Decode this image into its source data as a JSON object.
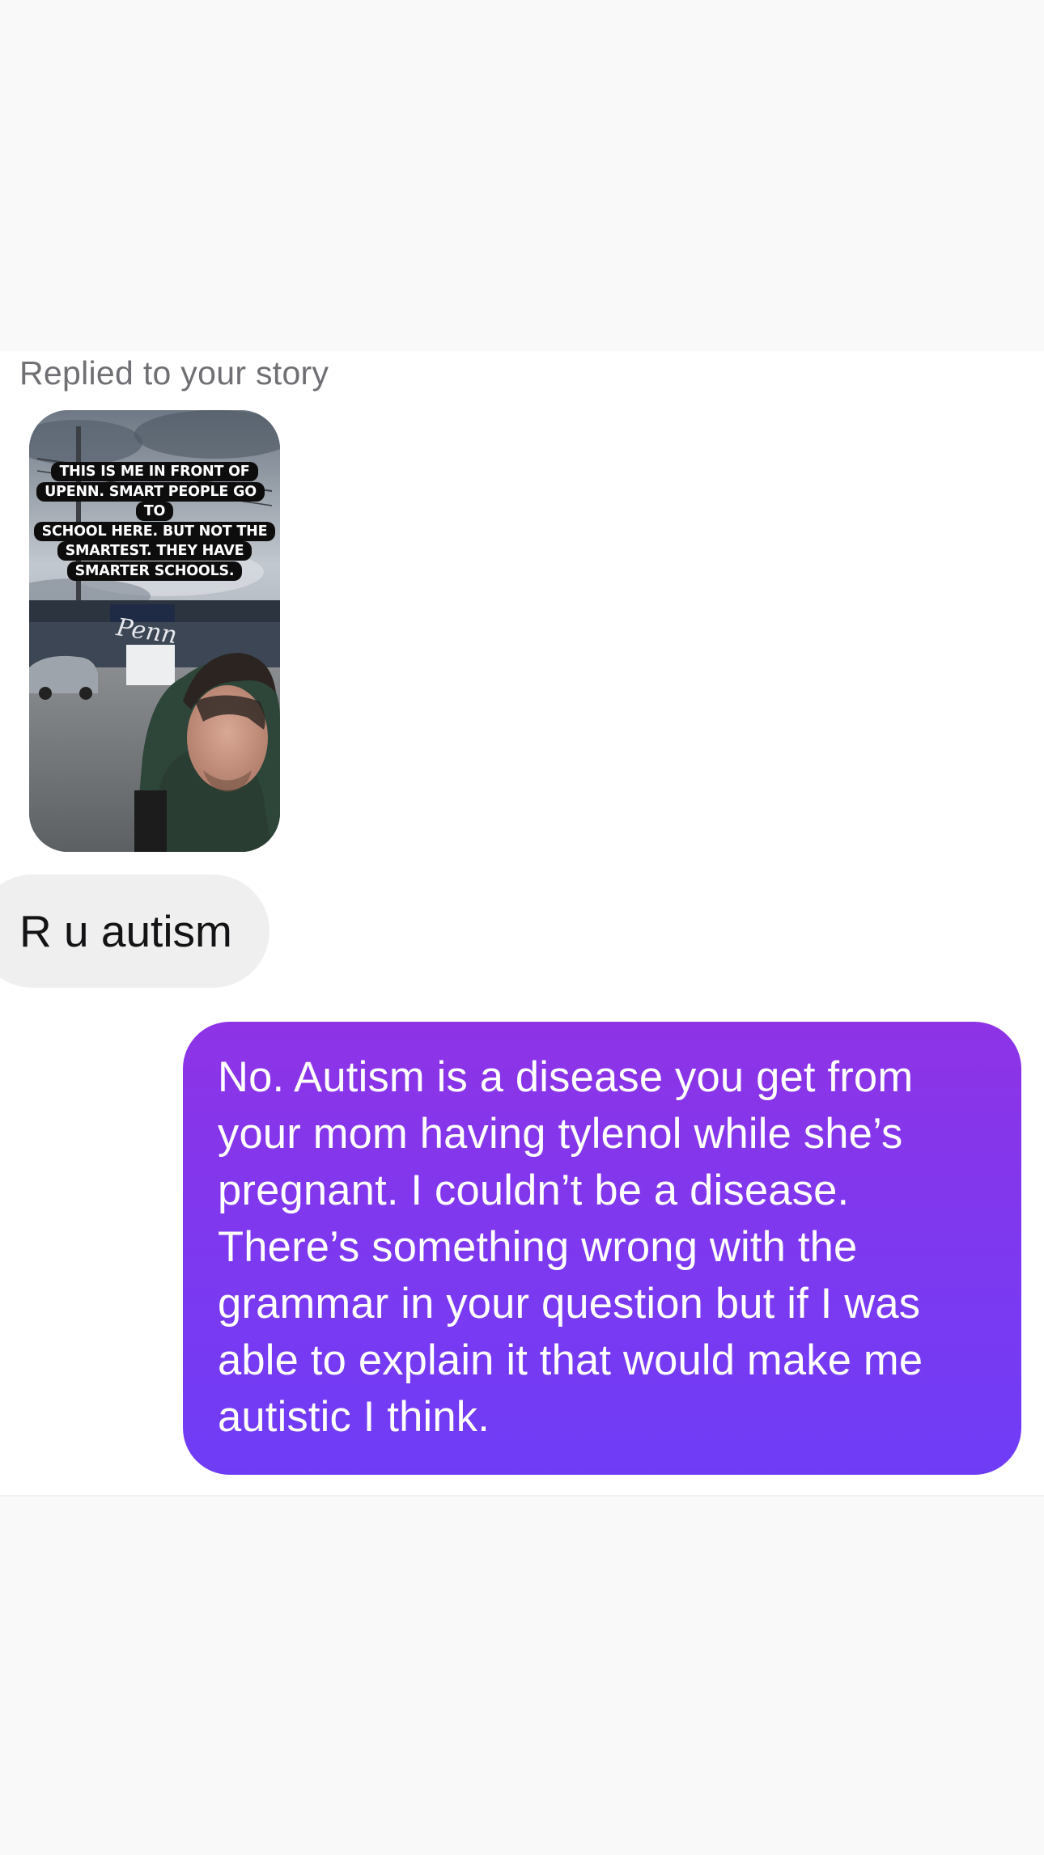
{
  "thread": {
    "context_label": "Replied to your story",
    "story": {
      "caption_lines": [
        "THIS IS ME IN FRONT OF",
        "UPENN. SMART PEOPLE GO TO",
        "SCHOOL HERE. BUT NOT THE",
        "SMARTEST. THEY HAVE",
        "SMARTER SCHOOLS."
      ],
      "sign_text": "Penn"
    },
    "messages": [
      {
        "direction": "incoming",
        "text": "R u autism"
      },
      {
        "direction": "outgoing",
        "text": "No. Autism is a disease you get from your mom having tylenol while she’s pregnant. I couldn’t be a disease. There’s something wrong with the grammar in your question but if I was able to explain it that would make me autistic I think."
      }
    ]
  },
  "colors": {
    "outgoing_bubble_top": "#8e33e6",
    "outgoing_bubble_bottom": "#6f3cf6",
    "incoming_bubble": "#efeff0",
    "label_gray": "#707074"
  }
}
